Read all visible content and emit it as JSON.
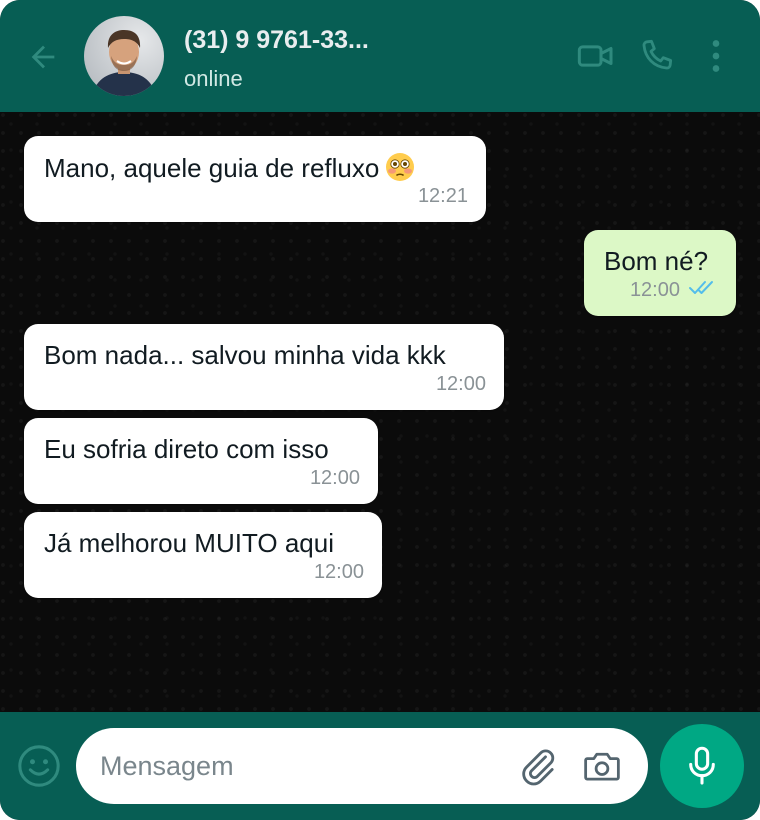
{
  "header": {
    "contact_name": "(31) 9 9761-33...",
    "status": "online",
    "icons": [
      "back-arrow-icon",
      "video-call-icon",
      "phone-call-icon",
      "more-options-icon"
    ]
  },
  "messages": [
    {
      "direction": "incoming",
      "text": "Mano, aquele guia de refluxo",
      "emoji": "flushed-face-emoji",
      "time": "12:21"
    },
    {
      "direction": "outgoing",
      "text": "Bom né?",
      "time": "12:00",
      "status": "read"
    },
    {
      "direction": "incoming",
      "text": "Bom nada... salvou minha vida kkk",
      "time": "12:00"
    },
    {
      "direction": "incoming",
      "text": "Eu sofria direto com isso",
      "time": "12:00"
    },
    {
      "direction": "incoming",
      "text": "Já melhorou MUITO aqui",
      "time": "12:00"
    }
  ],
  "composer": {
    "placeholder": "Mensagem",
    "value": "",
    "icons": [
      "emoji-icon",
      "attach-icon",
      "camera-icon",
      "mic-icon"
    ]
  },
  "colors": {
    "header": "#075e54",
    "outgoing_bubble": "#dcf8c6",
    "incoming_bubble": "#ffffff",
    "read_ticks": "#53bdeb",
    "mic_button": "#00a884"
  }
}
